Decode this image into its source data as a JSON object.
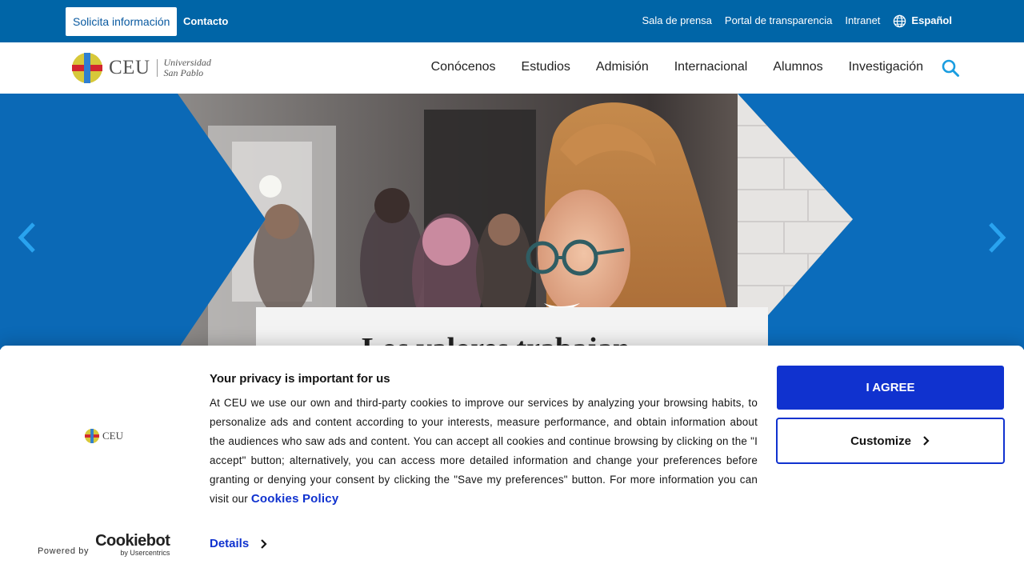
{
  "topbar": {
    "request_info": "Solicita información",
    "contact": "Contacto",
    "links": [
      "Sala de prensa",
      "Portal de transparencia",
      "Intranet"
    ],
    "language": "Español",
    "icons": {
      "language": "globe-icon"
    }
  },
  "header": {
    "logo_text": "CEU",
    "logo_sub_line1": "Universidad",
    "logo_sub_line2": "San Pablo",
    "menu": [
      "Conócenos",
      "Estudios",
      "Admisión",
      "Internacional",
      "Alumnos",
      "Investigación"
    ],
    "icons": {
      "search": "search-icon"
    }
  },
  "hero": {
    "title_partial": "Los valores trabajan",
    "icons": {
      "prev": "chevron-left-icon",
      "next": "chevron-right-icon"
    }
  },
  "cookie_banner": {
    "logo_text": "CEU",
    "heading": "Your privacy is important for us",
    "body": "At CEU we use our own and third-party cookies to improve our services by analyzing your browsing habits, to personalize ads and content according to your interests, measure performance, and obtain information about the audiences who saw ads and content. You can accept all cookies and continue browsing by clicking on the \"I accept\" button; alternatively, you can access more detailed information and change your preferences before granting or denying your consent by clicking the \"Save my preferences\" button. For more information you can visit our",
    "policy_link": "Cookies Policy",
    "details": "Details",
    "agree": "I AGREE",
    "customize": "Customize",
    "powered_by": "Powered by",
    "cookiebot_name": "Cookiebot",
    "cookiebot_by": "by Usercentrics"
  },
  "colors": {
    "topbar_bg": "#0065a7",
    "hero_blue": "#0a6fbf",
    "arrow": "#29a3ef",
    "cookie_accent": "#1032cf"
  }
}
